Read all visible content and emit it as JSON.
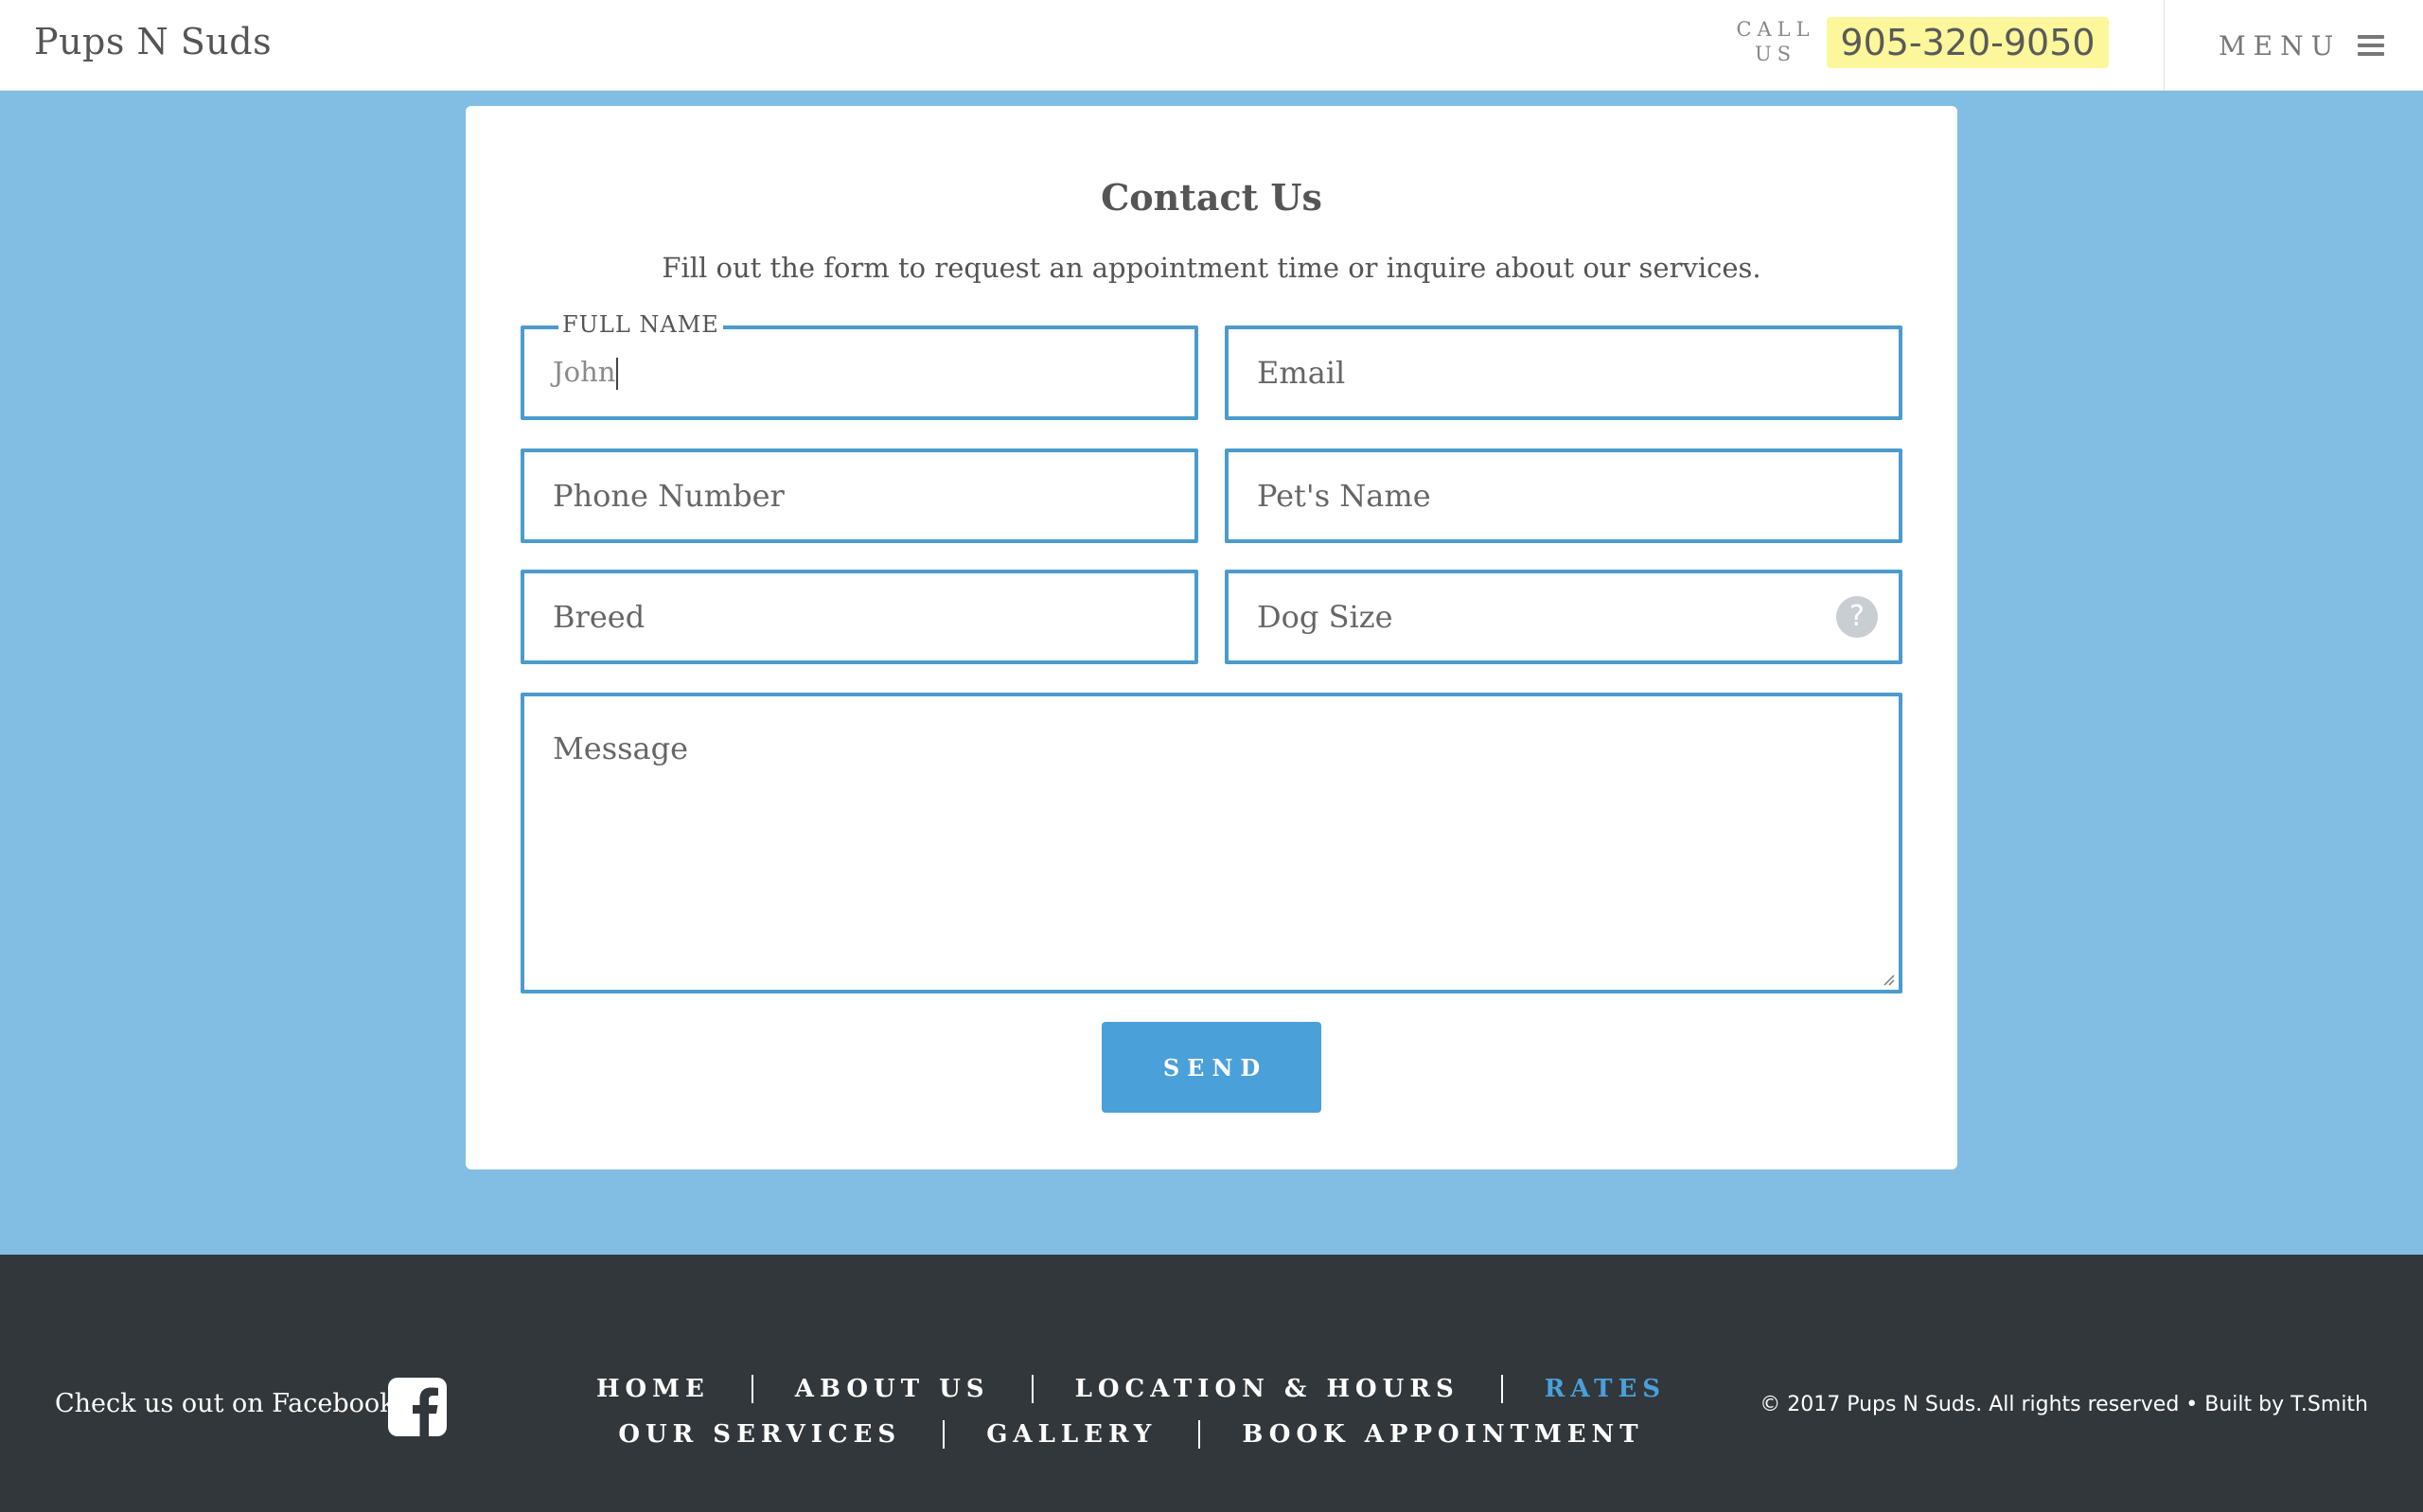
{
  "header": {
    "logo": "Pups N Suds",
    "call_label_line1": "CALL",
    "call_label_line2": "US",
    "phone": "905-320-9050",
    "menu_label": "MENU"
  },
  "contact": {
    "title": "Contact Us",
    "subtitle": "Fill out the form to request an appointment time or inquire about our services.",
    "full_name": {
      "label": "FULL NAME",
      "value": "John"
    },
    "email": {
      "placeholder": "Email"
    },
    "phone": {
      "placeholder": "Phone Number"
    },
    "pet_name": {
      "placeholder": "Pet's Name"
    },
    "breed": {
      "placeholder": "Breed"
    },
    "dog_size": {
      "placeholder": "Dog Size",
      "help": "?"
    },
    "message": {
      "placeholder": "Message"
    },
    "send_label": "SEND"
  },
  "footer": {
    "facebook_text": "Check us out on Facebook",
    "nav_row1": [
      "HOME",
      "ABOUT US",
      "LOCATION & HOURS",
      "RATES"
    ],
    "nav_row2": [
      "OUR SERVICES",
      "GALLERY",
      "BOOK APPOINTMENT"
    ],
    "active_item": "RATES",
    "copyright": "© 2017 Pups N Suds. All rights reserved  •  Built by T.Smith"
  },
  "colors": {
    "background_blue": "#82bee3",
    "field_border": "#4b9bcc",
    "button": "#4aa0d9",
    "phone_highlight": "#fbf79a",
    "footer_bg": "#32373b"
  }
}
